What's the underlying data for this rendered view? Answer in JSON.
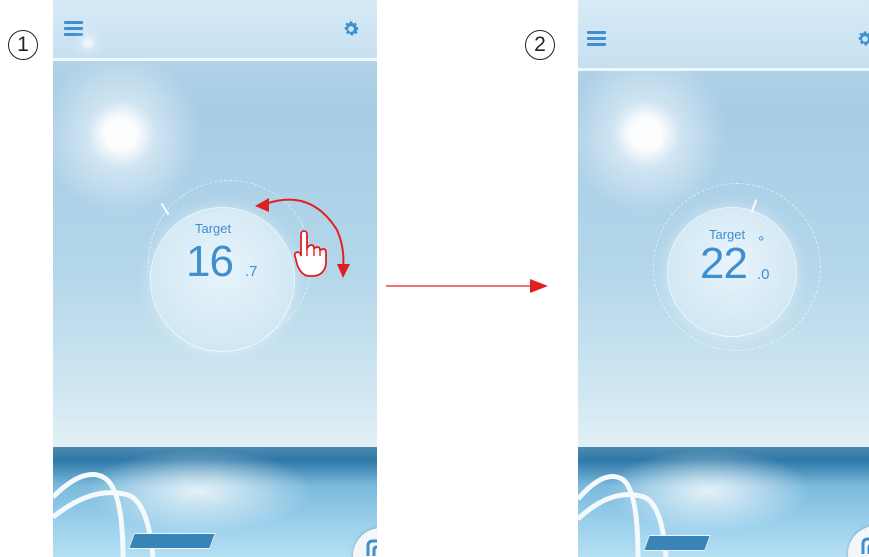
{
  "steps": [
    {
      "number": "1",
      "target_label": "Target",
      "temp_whole": "16",
      "temp_decimal": ".7",
      "temp_degree": ""
    },
    {
      "number": "2",
      "target_label": "Target",
      "temp_whole": "22",
      "temp_decimal": ".0",
      "temp_degree": "°"
    }
  ],
  "icons": {
    "menu": "hamburger-menu-icon",
    "settings": "gear-icon",
    "gesture": "pointing-hand-icon",
    "rotate": "rotate-arrow-icon",
    "flow": "right-arrow-icon",
    "corner": "curve-icon"
  },
  "colors": {
    "accent": "#3d8fd0",
    "gesture": "#e02020",
    "flow_arrow": "#e02020"
  }
}
